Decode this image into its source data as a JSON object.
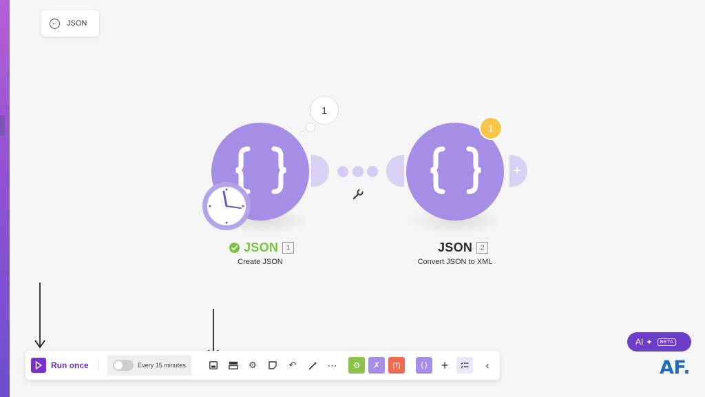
{
  "colors": {
    "brand_purple": "#a48ee6",
    "accent_purple": "#6d3fc8",
    "success_green": "#7ac142",
    "badge_yellow": "#f7c54a",
    "tool_green": "#8bc34a",
    "tool_purple": "#a48ee6",
    "tool_red": "#f26a4f",
    "logo_blue": "#1a6cc4"
  },
  "header": {
    "back_label": "JSON"
  },
  "modules": [
    {
      "name": "JSON",
      "index": "1",
      "subtitle": "Create JSON",
      "thought_count": "1",
      "status_icon": "check-circle-icon",
      "has_clock": true
    },
    {
      "name": "JSON",
      "index": "2",
      "subtitle": "Convert JSON to XML",
      "badge_count": "1",
      "add_icon": "plus-icon"
    }
  ],
  "connector": {
    "icon": "wrench-icon"
  },
  "toolbar": {
    "run_label": "Run once",
    "schedule_label": "Every 15 minutes",
    "schedule_enabled": false,
    "icons": [
      "save-icon",
      "layout-icon",
      "gear-icon",
      "note-icon",
      "undo-icon",
      "magic-wand-icon",
      "more-icon",
      "tools-gear-icon",
      "flow-control-icon",
      "text-parser-icon",
      "json-module-icon",
      "add-icon",
      "checklist-icon",
      "chevron-left-icon"
    ]
  },
  "ai": {
    "label": "AI",
    "beta_label": "BETA"
  },
  "logo": {
    "text": "AF."
  }
}
